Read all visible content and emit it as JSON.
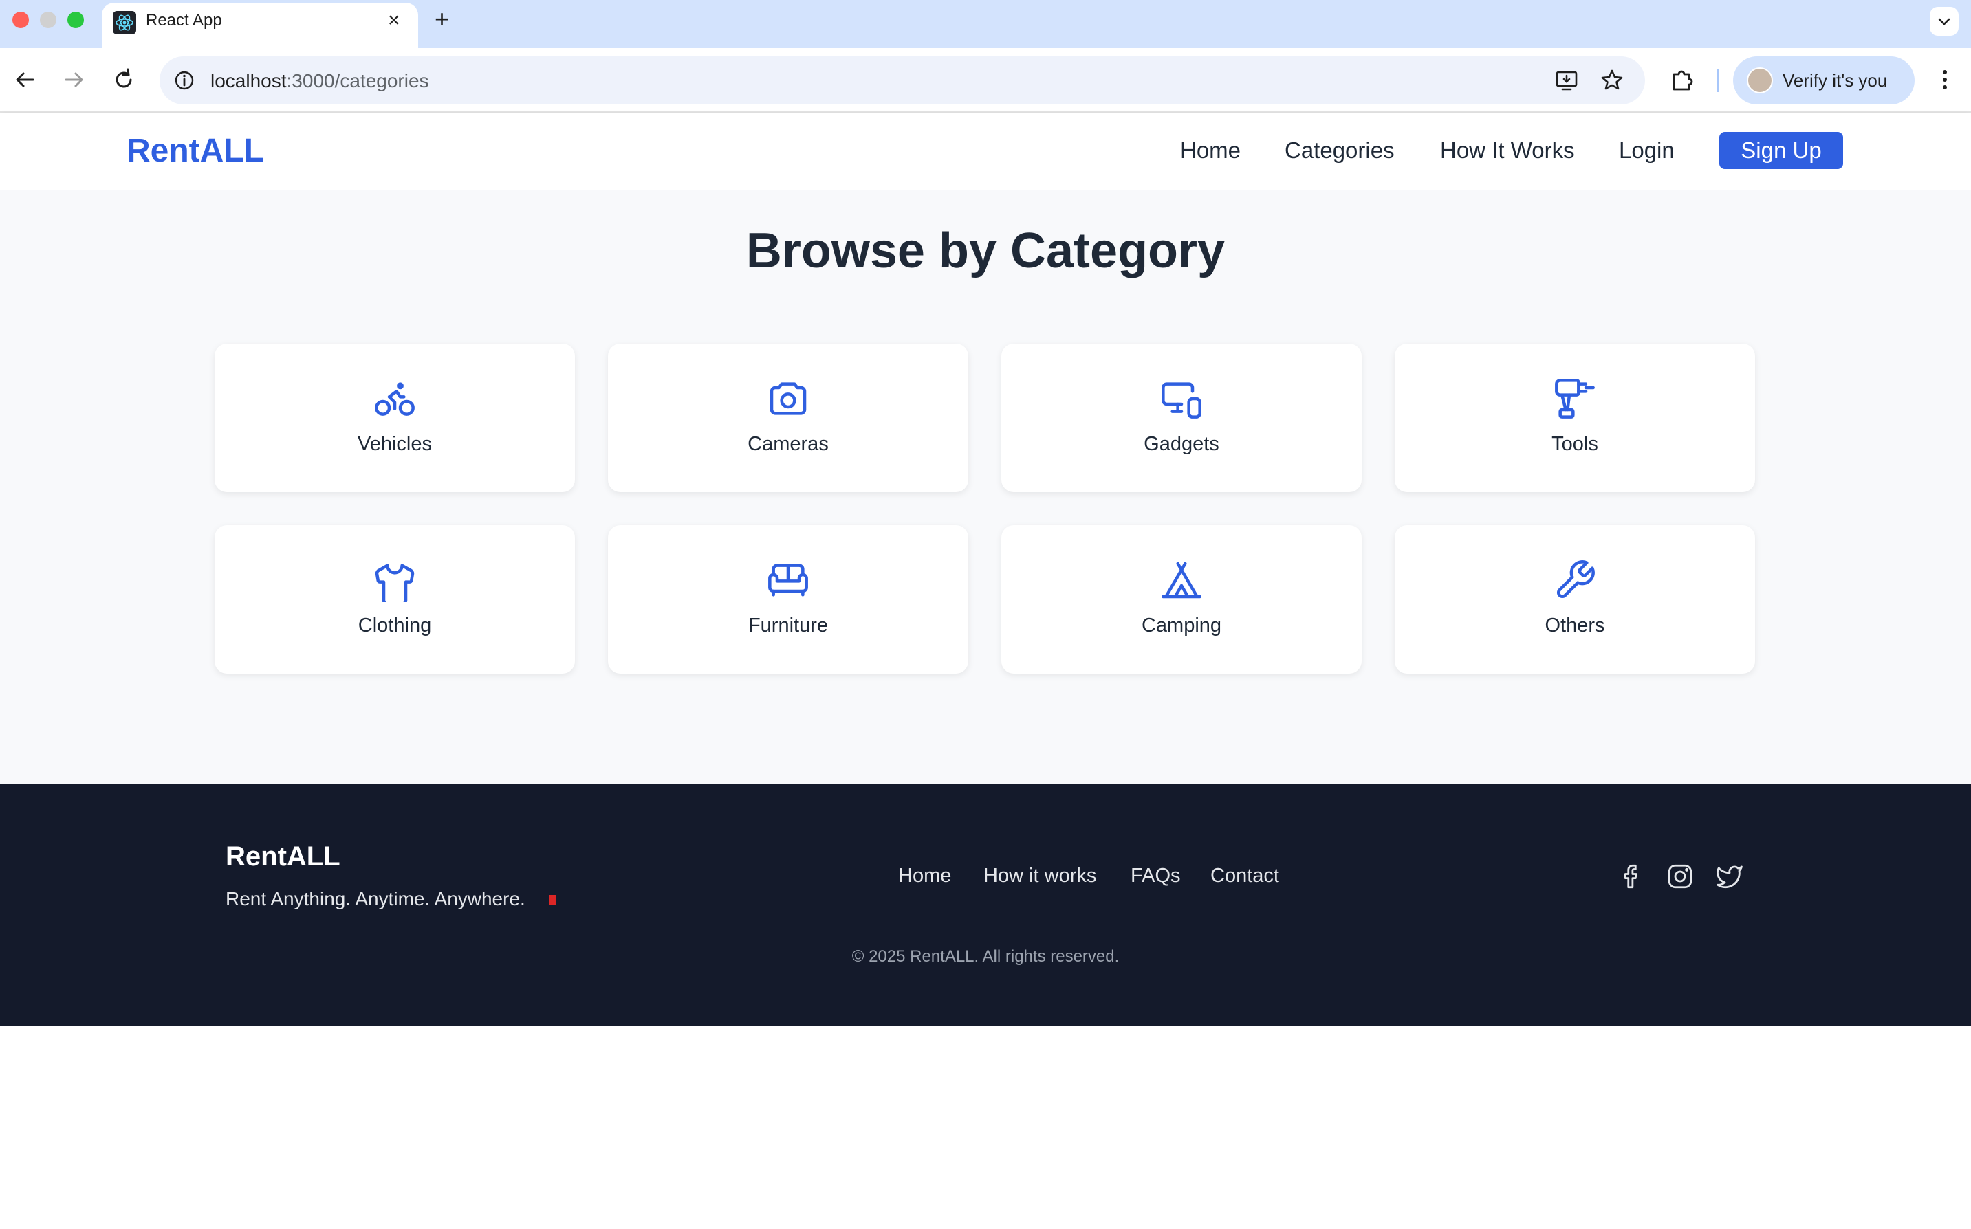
{
  "browser": {
    "tab_title": "React App",
    "url_host": "localhost",
    "url_path": ":3000/categories",
    "verify_label": "Verify it's you"
  },
  "nav": {
    "brand": "RentALL",
    "links": [
      "Home",
      "Categories",
      "How It Works",
      "Login"
    ],
    "signup_label": "Sign Up"
  },
  "main": {
    "heading": "Browse by Category",
    "categories": [
      {
        "label": "Vehicles",
        "icon": "bike-icon"
      },
      {
        "label": "Cameras",
        "icon": "camera-icon"
      },
      {
        "label": "Gadgets",
        "icon": "devices-icon"
      },
      {
        "label": "Tools",
        "icon": "drill-icon"
      },
      {
        "label": "Clothing",
        "icon": "shirt-icon"
      },
      {
        "label": "Furniture",
        "icon": "sofa-icon"
      },
      {
        "label": "Camping",
        "icon": "tent-icon"
      },
      {
        "label": "Others",
        "icon": "wrench-icon"
      }
    ]
  },
  "footer": {
    "brand": "RentALL",
    "tagline": "Rent Anything. Anytime. Anywhere.",
    "links": [
      "Home",
      "How it works",
      "FAQs",
      "Contact"
    ],
    "social": [
      "facebook-icon",
      "instagram-icon",
      "twitter-icon"
    ],
    "copyright": "© 2025 RentALL. All rights reserved."
  },
  "colors": {
    "accent": "#2f5fe0",
    "footer_bg": "#141a2b",
    "page_bg": "#f8f9fb",
    "text_dark": "#1f2937"
  }
}
